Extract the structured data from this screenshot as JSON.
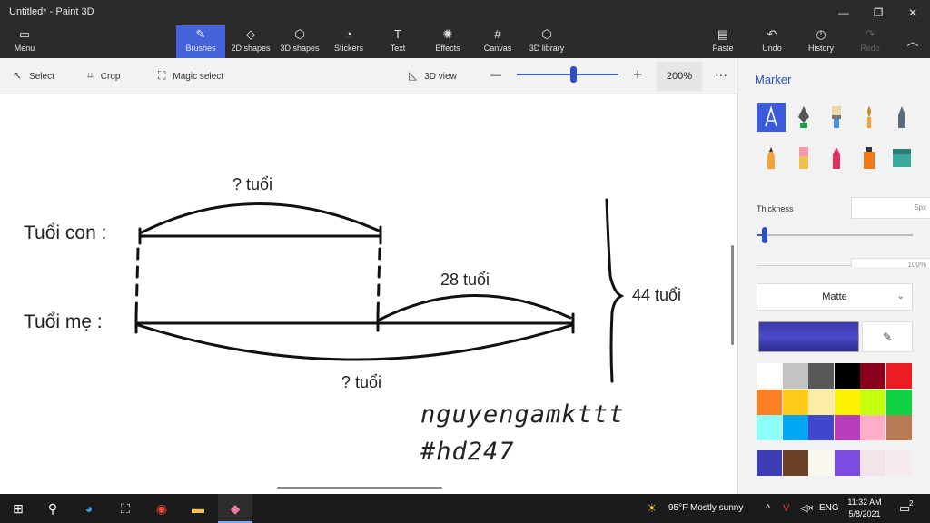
{
  "window": {
    "title": "Untitled* - Paint 3D",
    "minimize": "—",
    "maximize": "❐",
    "close": "✕"
  },
  "ribbon": {
    "menu": "Menu",
    "brushes": "Brushes",
    "shapes2d": "2D shapes",
    "shapes3d": "3D shapes",
    "stickers": "Stickers",
    "text": "Text",
    "effects": "Effects",
    "canvas": "Canvas",
    "library3d": "3D library",
    "paste": "Paste",
    "undo": "Undo",
    "history": "History",
    "redo": "Redo"
  },
  "toolbar": {
    "select": "Select",
    "crop": "Crop",
    "magic_select": "Magic select",
    "view3d": "3D view",
    "zoom_minus": "—",
    "zoom_plus": "+",
    "zoom_value": "200%",
    "zoom_level": 0.55,
    "more": "···"
  },
  "drawing": {
    "label_con": "Tuổi con :",
    "label_me": "Tuổi mẹ  :",
    "unknown_top": "? tuổi",
    "diff": "28 tuổi",
    "total": "44 tuổi",
    "unknown_bottom": "? tuổi",
    "signature_1": "nguyengamkttt",
    "signature_2": "#hd247"
  },
  "panel": {
    "title": "Marker",
    "thickness_label": "Thickness",
    "thickness_value": "5px",
    "thickness_level": 0.05,
    "opacity_value": "100%",
    "finish": "Matte",
    "current_color": "#3d3db5",
    "brushes": [
      "marker-icon",
      "calligraphy-pen-icon",
      "oil-brush-icon",
      "watercolor-icon",
      "pixel-pen-icon",
      "pencil-icon",
      "eraser-icon",
      "crayon-icon",
      "spray-can-icon",
      "fill-icon"
    ],
    "palette": [
      "#ffffff",
      "#c3c3c3",
      "#585858",
      "#000000",
      "#88001b",
      "#ec1c24",
      "#ff7f27",
      "#ffca18",
      "#fdeca6",
      "#fff200",
      "#c4ff0e",
      "#0ed145",
      "#8cfffb",
      "#00a8f3",
      "#3f48cc",
      "#b83dba",
      "#ffaec8",
      "#b97a56"
    ],
    "custom_palette": [
      "#3d3db5",
      "#6b4226",
      "#fbf8f0",
      "#7d4be0",
      "#f3e4ea",
      "#f5eaec"
    ]
  },
  "taskbar": {
    "weather": "95°F  Mostly sunny",
    "lang": "ENG",
    "time": "11:32 AM",
    "date": "5/8/2021",
    "notifications": "2"
  }
}
